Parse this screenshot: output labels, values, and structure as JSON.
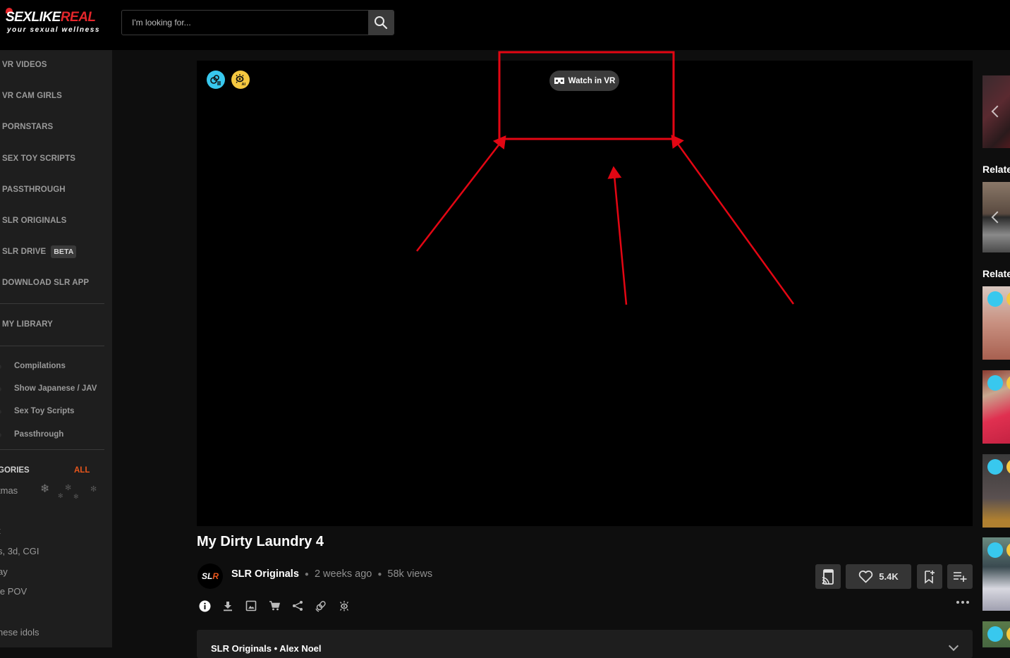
{
  "header": {
    "logo": {
      "brand_white": "SEXLIKE",
      "brand_red": "REAL",
      "tagline": "your sexual wellness"
    },
    "search": {
      "placeholder": "I'm looking for...",
      "value": ""
    }
  },
  "sidebar": {
    "nav": [
      {
        "label": "VR VIDEOS"
      },
      {
        "label": "VR CAM GIRLS"
      },
      {
        "label": "PORNSTARS"
      },
      {
        "label": "SEX TOY SCRIPTS"
      },
      {
        "label": "PASSTHROUGH"
      },
      {
        "label": "SLR ORIGINALS"
      },
      {
        "label": "SLR DRIVE",
        "badge": "BETA"
      },
      {
        "label": "DOWNLOAD SLR APP"
      }
    ],
    "library_label": "MY LIBRARY",
    "filters": [
      {
        "label": "Compilations"
      },
      {
        "label": "Show Japanese / JAV"
      },
      {
        "label": "Sex Toy Scripts"
      },
      {
        "label": "Passthrough"
      }
    ],
    "categories_title": "CATEGORIES",
    "categories_title_visible": "GORIES",
    "categories_all": "ALL",
    "categories": [
      {
        "label": "tmas"
      },
      {
        "label": "t"
      },
      {
        "label": "s, 3d, CGI"
      },
      {
        "label": "ay"
      },
      {
        "label": "le POV"
      },
      {
        "label": "nese idols"
      }
    ]
  },
  "player": {
    "badges": [
      "sex-toy-script-icon",
      "ai-passthrough-icon"
    ],
    "watch_vr_label": "Watch in VR",
    "annotation_color": "#e30613"
  },
  "video": {
    "title": "My Dirty Laundry 4",
    "channel_avatar": {
      "left": "SL",
      "right": "R"
    },
    "channel": "SLR Originals",
    "age": "2 weeks ago",
    "views": "58k views",
    "likes": "5.4K",
    "toolbar_icons": [
      "info-icon",
      "download-icon",
      "gallery-icon",
      "cart-icon",
      "share-icon",
      "sex-toy-icon",
      "passthrough-icon"
    ],
    "description_preview": "SLR Originals • Alex Noel"
  },
  "right_column": {
    "related_titles": [
      "Related",
      "Related"
    ]
  },
  "colors": {
    "accent_orange": "#e8561c",
    "brand_red": "#e3262b",
    "badge_blue": "#38c8ee",
    "badge_yellow": "#f5c840"
  }
}
